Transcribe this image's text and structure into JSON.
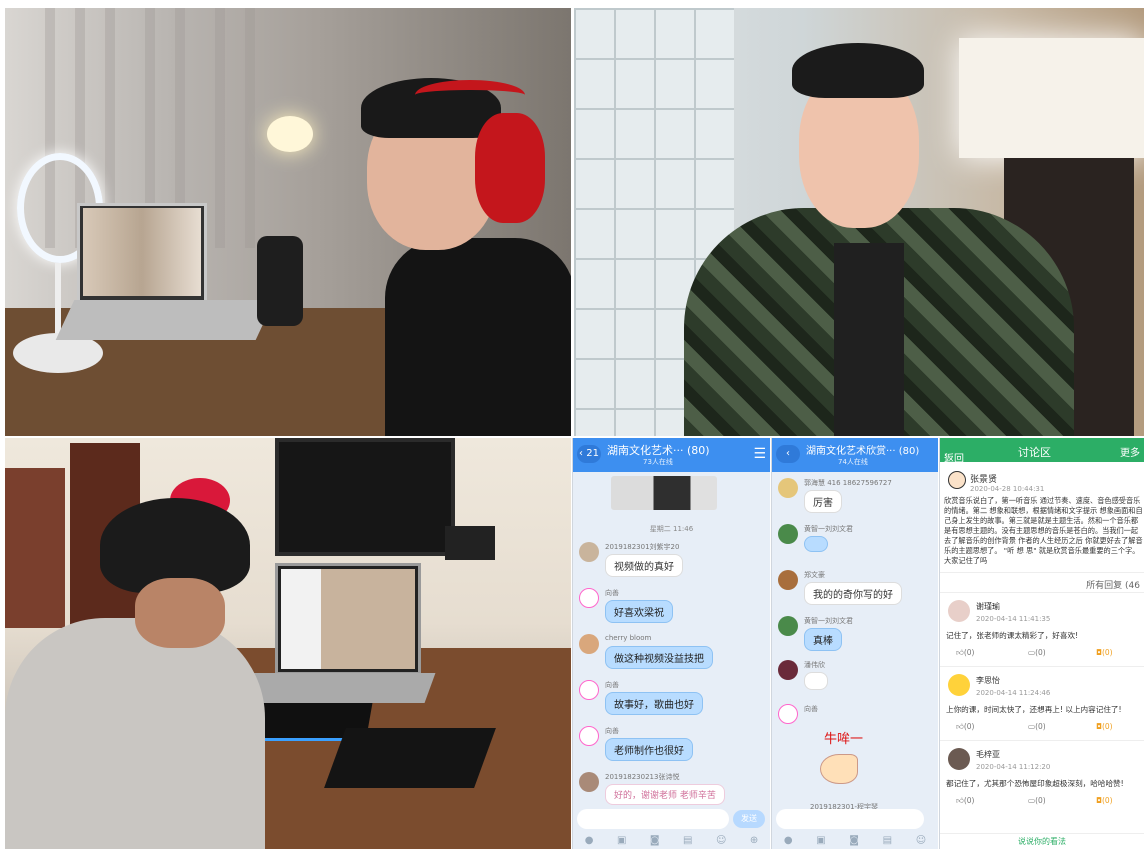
{
  "collage": {
    "photos": [
      {
        "name": "teacher-teaching-online-at-laptop-with-headphones"
      },
      {
        "name": "teacher-portrait-with-headset-mic"
      },
      {
        "name": "student-watching-online-class-on-laptop"
      }
    ]
  },
  "chat1": {
    "back_badge": "21",
    "title": "湖南文化艺术··· (80)",
    "subtitle": "73人在线",
    "timestamp": "星期二 11:46",
    "messages": [
      {
        "sender": "2019182301刘紫宇20",
        "text": "视频做的真好"
      },
      {
        "sender": "向善",
        "text": "好喜欢梁祝"
      },
      {
        "sender": "cherry bloom",
        "text": "做这种视频没益技把"
      },
      {
        "sender": "向善",
        "text": "故事好，歌曲也好"
      },
      {
        "sender": "向善",
        "text": "老师制作也很好"
      },
      {
        "sender": "201918230213张诗悦",
        "text": "好的，谢谢老师 老师辛苦"
      }
    ],
    "send_label": "发送"
  },
  "chat2": {
    "title": "湖南文化艺术欣赏··· (80)",
    "subtitle": "74人在线",
    "messages": [
      {
        "sender": "郭海慧 416 18627596727",
        "text": "厉害"
      },
      {
        "sender": "黄智一刘刘文君",
        "text": ""
      },
      {
        "sender": "郑文豪",
        "text": "我的的奇你写的好"
      },
      {
        "sender": "黄智一刘刘文君",
        "text": "真棒"
      },
      {
        "sender": "潘伟欣",
        "text": ""
      },
      {
        "sender": "向善",
        "text": ""
      }
    ],
    "sticker_text": "牛哞一",
    "last_sender": "2019182301-程宇琴"
  },
  "forum": {
    "back": "返回",
    "title": "讨论区",
    "more": "更多",
    "post_author": "张景贤",
    "post_time": "2020-04-28 10:44:31",
    "post_body": "欣赏音乐说白了，第一听音乐 通过节奏、速度、音色感受音乐的情绪。第二 想象和联想，根据情绪和文字提示 想象画面和自己身上发生的故事。第三就是就是主题生活。然和一个音乐都是有思想主题的。没有主题思想的音乐是苍白的。当我们一起去了解音乐的创作背景 作者的人生经历之后 你就更好去了解音乐的主题思想了。 \"听 想 思\" 就是欣赏音乐最重要的三个字。大家记住了吗",
    "all_replies": "所有回复 (46",
    "comments": [
      {
        "name": "谢瑾瑜",
        "time": "2020-04-14 11:41:35",
        "text": "记住了，张老师的课太精彩了，好喜欢!",
        "like": "(0)",
        "reply": "(0)",
        "reward": "(0)"
      },
      {
        "name": "李思怡",
        "time": "2020-04-14 11:24:46",
        "text": "上你的课，时间太快了，还想再上! 以上内容记住了!",
        "like": "(0)",
        "reply": "(0)",
        "reward": "(0)"
      },
      {
        "name": "毛梓亚",
        "time": "2020-04-14 11:12:20",
        "text": "都记住了，尤其那个恐怖屋印象超极深刻，哈哈哈赞!",
        "like": "(0)",
        "reply": "(0)",
        "reward": "(0)"
      }
    ],
    "footer": "说说你的看法"
  },
  "colors": {
    "chat_blue": "#3d8ff0",
    "bubble_blue": "#b8dcff",
    "forum_green": "#2cae66",
    "reward_orange": "#f0a020"
  }
}
